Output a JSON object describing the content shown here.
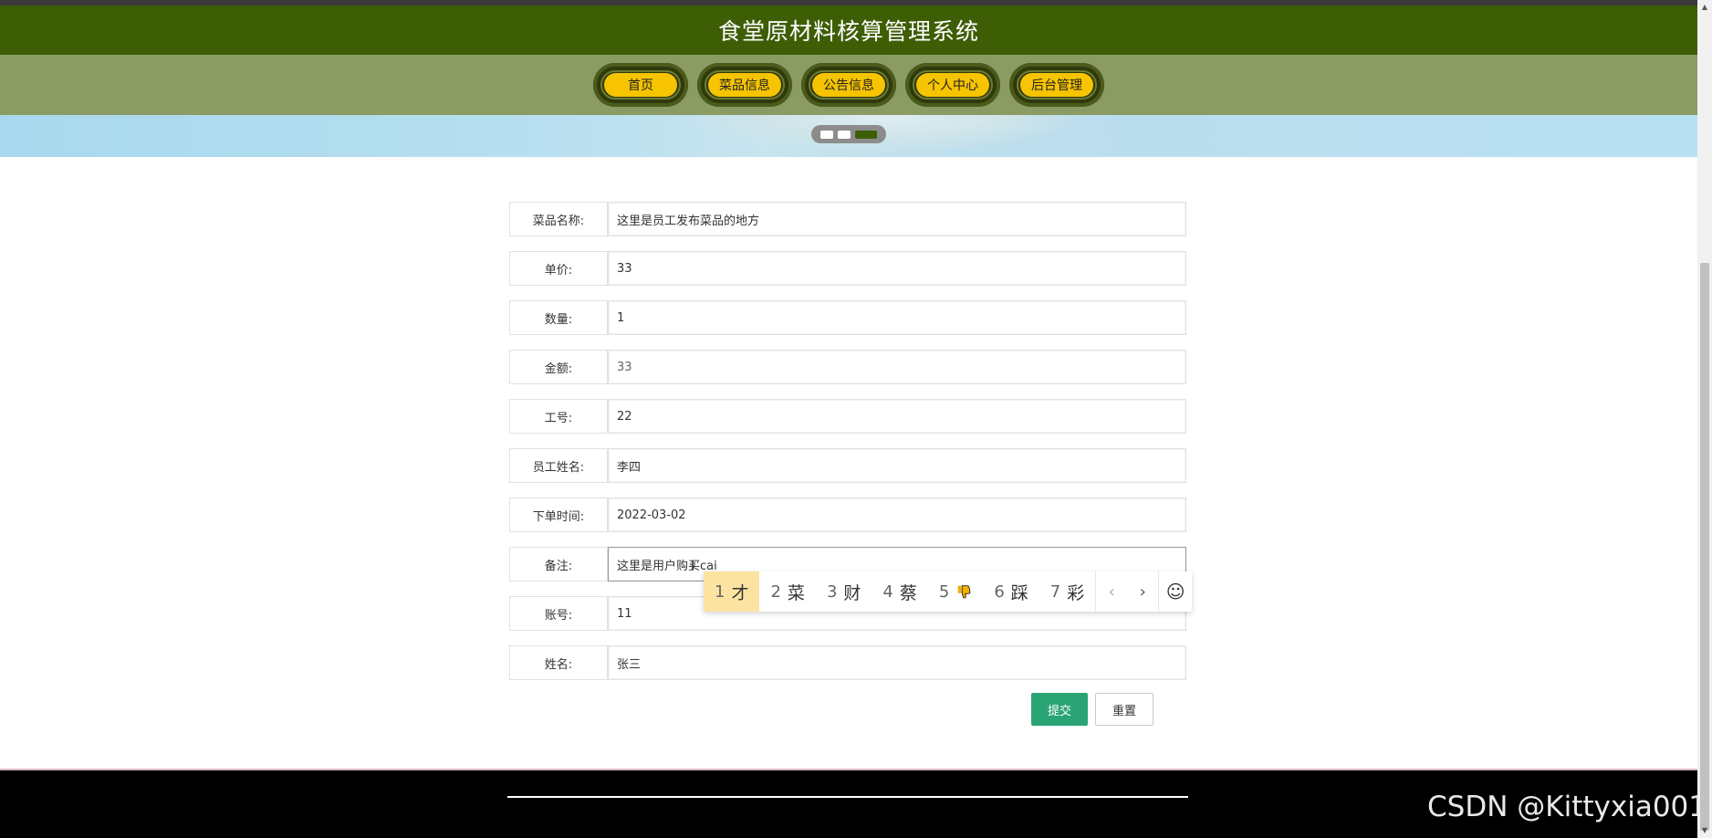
{
  "header": {
    "title": "食堂原材料核算管理系统"
  },
  "nav": {
    "items": [
      {
        "label": "首页"
      },
      {
        "label": "菜品信息"
      },
      {
        "label": "公告信息"
      },
      {
        "label": "个人中心"
      },
      {
        "label": "后台管理"
      }
    ]
  },
  "carousel": {
    "count": 3,
    "active_index": 2
  },
  "form": {
    "fields": [
      {
        "label": "菜品名称:",
        "value": "这里是员工发布菜品的地方"
      },
      {
        "label": "单价:",
        "value": "33"
      },
      {
        "label": "数量:",
        "value": "1"
      },
      {
        "label": "金额:",
        "value": "33"
      },
      {
        "label": "工号:",
        "value": "22"
      },
      {
        "label": "员工姓名:",
        "value": "李四"
      },
      {
        "label": "下单时间:",
        "value": "2022-03-02"
      },
      {
        "label": "备注:",
        "value": "这里是用户购买cai"
      },
      {
        "label": "账号:",
        "value": "11"
      },
      {
        "label": "姓名:",
        "value": "张三"
      }
    ],
    "submit_label": "提交",
    "reset_label": "重置"
  },
  "ime": {
    "candidates": [
      {
        "num": "1",
        "text": "才"
      },
      {
        "num": "2",
        "text": "菜"
      },
      {
        "num": "3",
        "text": "财"
      },
      {
        "num": "4",
        "text": "蔡"
      },
      {
        "num": "5",
        "text": "",
        "icon": "thumbs-down-icon"
      },
      {
        "num": "6",
        "text": "踩"
      },
      {
        "num": "7",
        "text": "彩"
      }
    ],
    "prev_glyph": "‹",
    "next_glyph": "›",
    "emoji_glyph": "☺",
    "highlight_color": "#fde3a1"
  },
  "colors": {
    "header_bg": "#3e5e06",
    "nav_bg": "#8a9b63",
    "nav_button": "#f6c400",
    "submit_button": "#2aa475"
  },
  "watermark": "CSDN @Kittyxia001"
}
